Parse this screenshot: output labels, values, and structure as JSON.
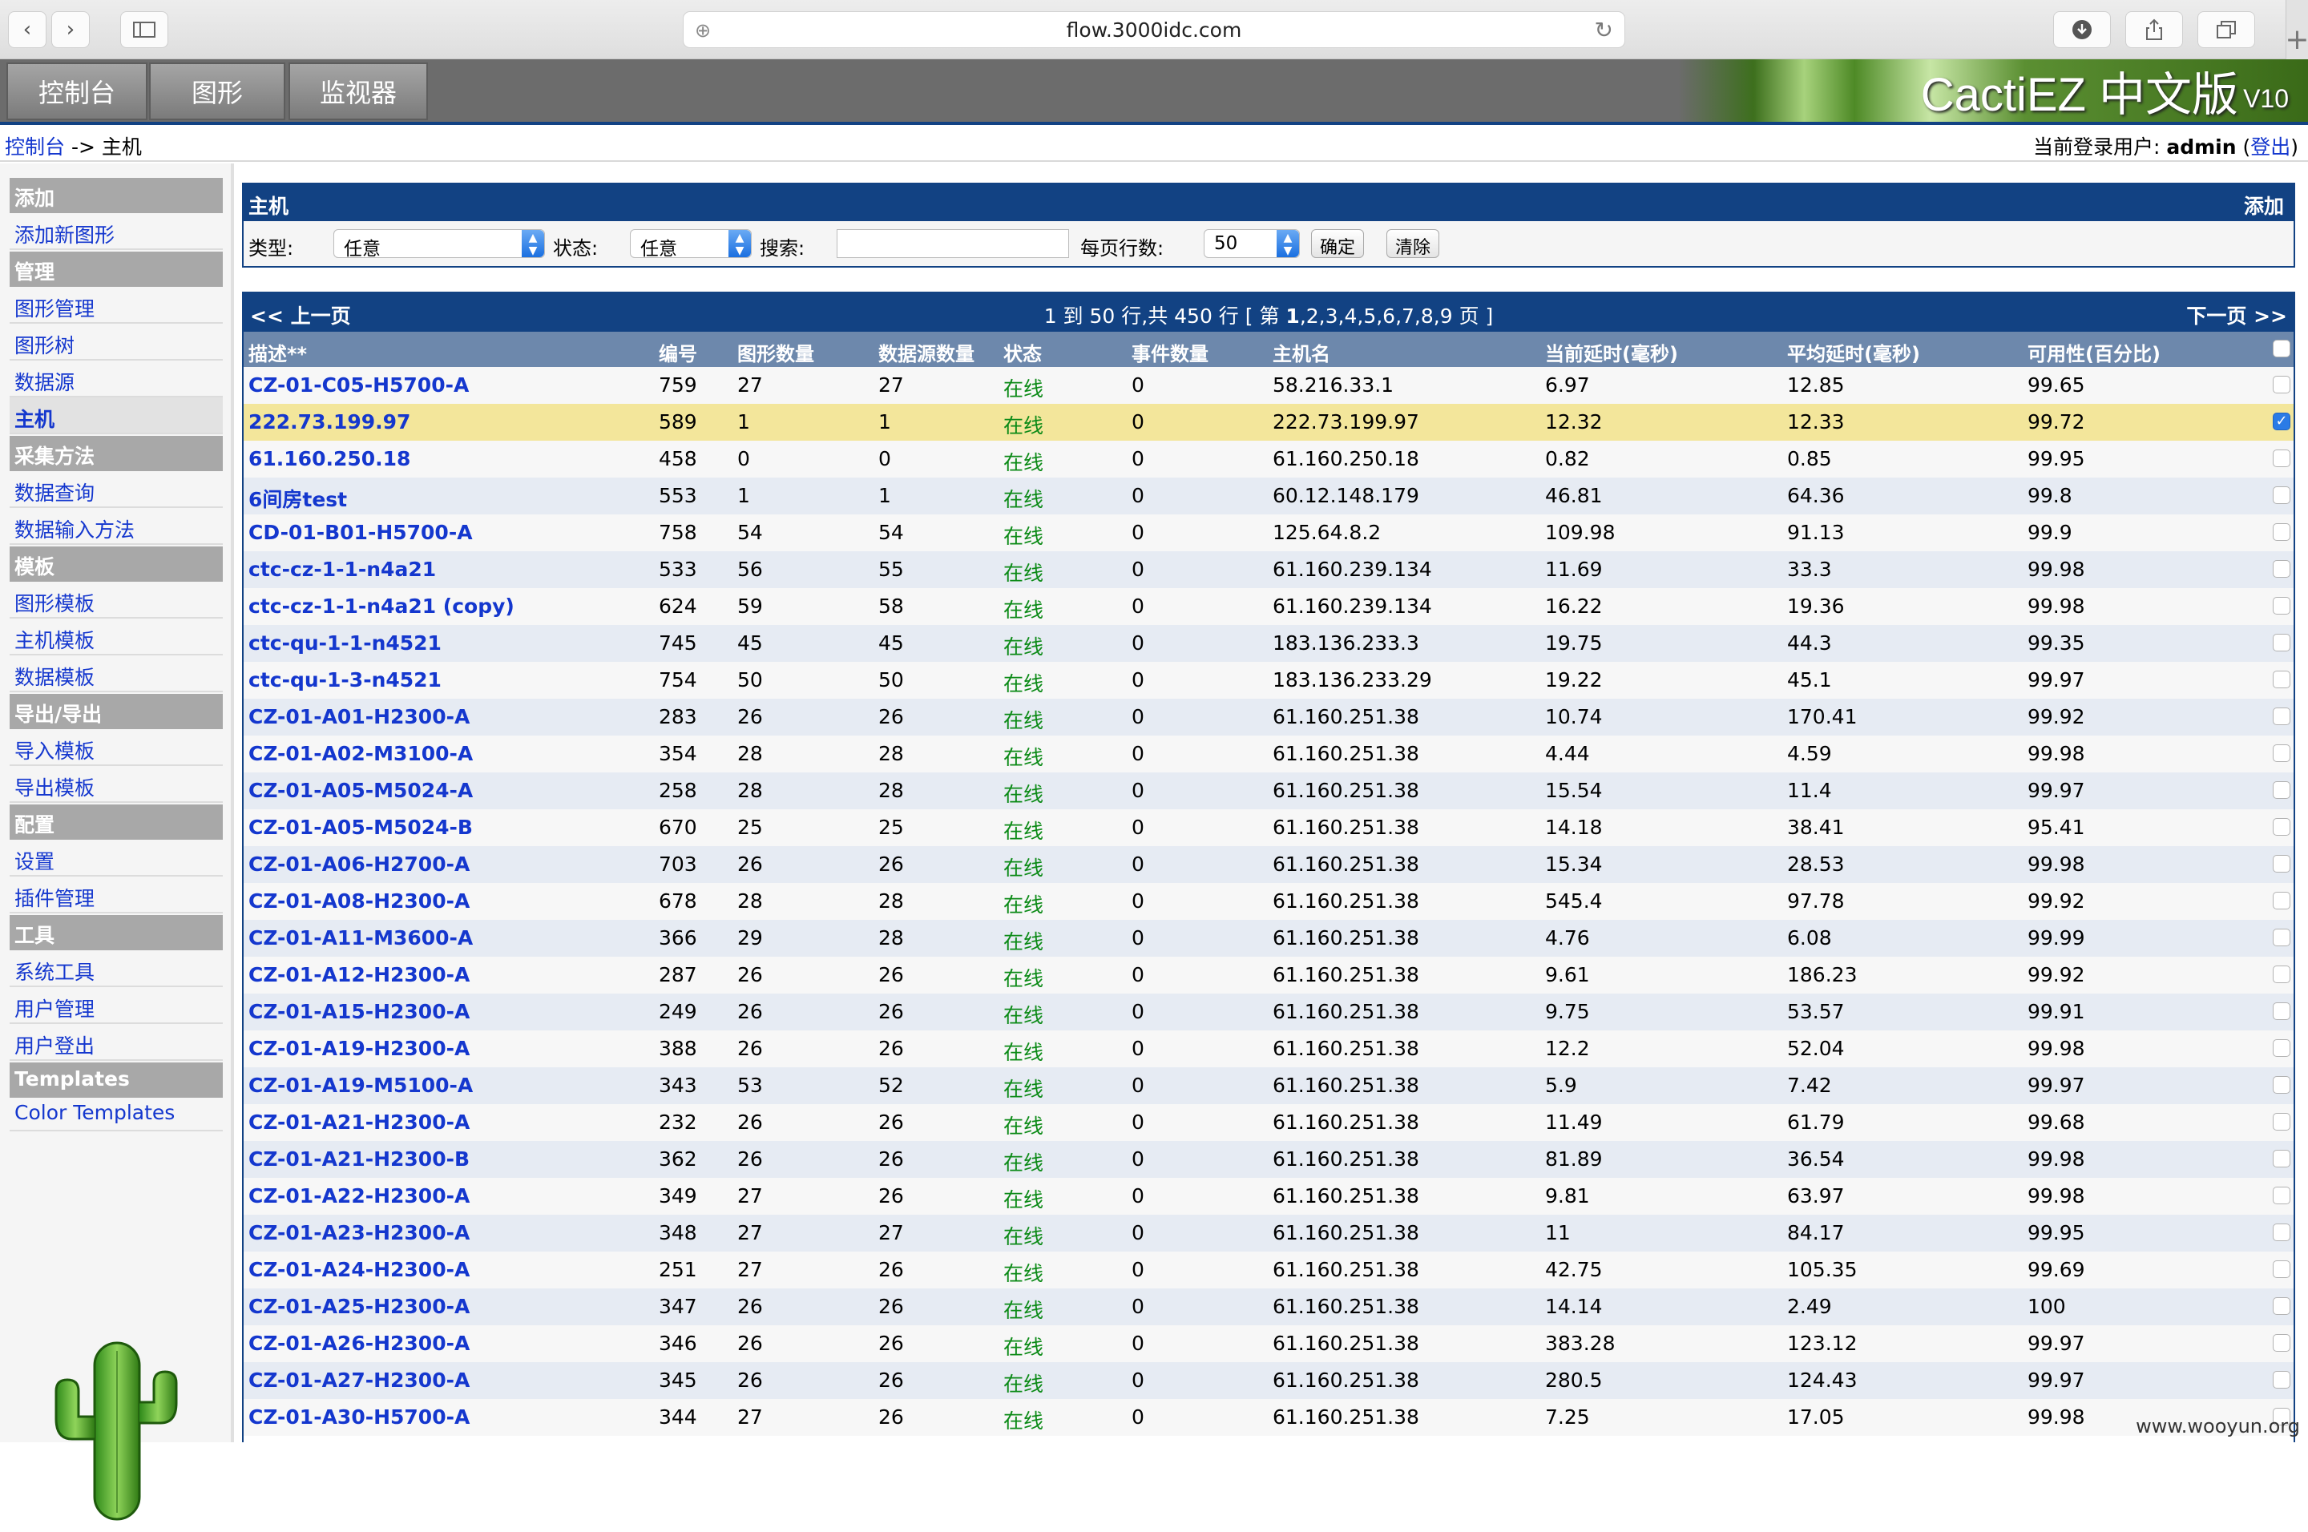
{
  "browser": {
    "url": "flow.3000idc.com",
    "new_tab_symbol": "+"
  },
  "header": {
    "tabs": [
      "控制台",
      "图形",
      "监视器"
    ],
    "logo": "CactiEZ 中文版",
    "logo_version": "V10"
  },
  "breadcrumb": {
    "root": "控制台",
    "sep": " -> ",
    "current": "主机"
  },
  "user": {
    "prefix": "当前登录用户: ",
    "name": "admin",
    "open": " (",
    "logout": "登出",
    "close": ")"
  },
  "sidebar": [
    {
      "type": "header",
      "label": "添加"
    },
    {
      "type": "item",
      "label": "添加新图形"
    },
    {
      "type": "header",
      "label": "管理"
    },
    {
      "type": "item",
      "label": "图形管理"
    },
    {
      "type": "item",
      "label": "图形树"
    },
    {
      "type": "item",
      "label": "数据源"
    },
    {
      "type": "item",
      "label": "主机",
      "selected": true
    },
    {
      "type": "header",
      "label": "采集方法"
    },
    {
      "type": "item",
      "label": "数据查询"
    },
    {
      "type": "item",
      "label": "数据输入方法"
    },
    {
      "type": "header",
      "label": "模板"
    },
    {
      "type": "item",
      "label": "图形模板"
    },
    {
      "type": "item",
      "label": "主机模板"
    },
    {
      "type": "item",
      "label": "数据模板"
    },
    {
      "type": "header",
      "label": "导出/导出"
    },
    {
      "type": "item",
      "label": "导入模板"
    },
    {
      "type": "item",
      "label": "导出模板"
    },
    {
      "type": "header",
      "label": "配置"
    },
    {
      "type": "item",
      "label": "设置"
    },
    {
      "type": "item",
      "label": "插件管理"
    },
    {
      "type": "header",
      "label": "工具"
    },
    {
      "type": "item",
      "label": "系统工具"
    },
    {
      "type": "item",
      "label": "用户管理"
    },
    {
      "type": "item",
      "label": "用户登出"
    },
    {
      "type": "header",
      "label": "Templates"
    },
    {
      "type": "item",
      "label": "Color Templates"
    }
  ],
  "filter": {
    "title": "主机",
    "add": "添加",
    "type_label": "类型:",
    "type_value": "任意",
    "status_label": "状态:",
    "status_value": "任意",
    "search_label": "搜索:",
    "search_value": "",
    "rows_label": "每页行数:",
    "rows_value": "50",
    "go": "确定",
    "clear": "清除"
  },
  "pager": {
    "prev": "<< 上一页",
    "summary_pre": "1 到 50 行,共 450 行 [ 第 ",
    "current_page": "1",
    "other_pages": ",2,3,4,5,6,7,8,9",
    "summary_post": " 页 ]",
    "next": "下一页 >>"
  },
  "columns": [
    "描述**",
    "编号",
    "图形数量",
    "数据源数量",
    "状态",
    "事件数量",
    "主机名",
    "当前延时(毫秒)",
    "平均延时(毫秒)",
    "可用性(百分比)"
  ],
  "rows": [
    {
      "desc": "CZ-01-C05-H5700-A",
      "id": "759",
      "graphs": "27",
      "ds": "27",
      "status": "在线",
      "events": "0",
      "host": "58.216.33.1",
      "cur": "6.97",
      "avg": "12.85",
      "avail": "99.65",
      "checked": false
    },
    {
      "desc": "222.73.199.97",
      "id": "589",
      "graphs": "1",
      "ds": "1",
      "status": "在线",
      "events": "0",
      "host": "222.73.199.97",
      "cur": "12.32",
      "avg": "12.33",
      "avail": "99.72",
      "checked": true
    },
    {
      "desc": "61.160.250.18",
      "id": "458",
      "graphs": "0",
      "ds": "0",
      "status": "在线",
      "events": "0",
      "host": "61.160.250.18",
      "cur": "0.82",
      "avg": "0.85",
      "avail": "99.95",
      "checked": false
    },
    {
      "desc": "6间房test",
      "id": "553",
      "graphs": "1",
      "ds": "1",
      "status": "在线",
      "events": "0",
      "host": "60.12.148.179",
      "cur": "46.81",
      "avg": "64.36",
      "avail": "99.8",
      "checked": false
    },
    {
      "desc": "CD-01-B01-H5700-A",
      "id": "758",
      "graphs": "54",
      "ds": "54",
      "status": "在线",
      "events": "0",
      "host": "125.64.8.2",
      "cur": "109.98",
      "avg": "91.13",
      "avail": "99.9",
      "checked": false
    },
    {
      "desc": "ctc-cz-1-1-n4a21",
      "id": "533",
      "graphs": "56",
      "ds": "55",
      "status": "在线",
      "events": "0",
      "host": "61.160.239.134",
      "cur": "11.69",
      "avg": "33.3",
      "avail": "99.98",
      "checked": false
    },
    {
      "desc": "ctc-cz-1-1-n4a21 (copy)",
      "id": "624",
      "graphs": "59",
      "ds": "58",
      "status": "在线",
      "events": "0",
      "host": "61.160.239.134",
      "cur": "16.22",
      "avg": "19.36",
      "avail": "99.98",
      "checked": false
    },
    {
      "desc": "ctc-qu-1-1-n4521",
      "id": "745",
      "graphs": "45",
      "ds": "45",
      "status": "在线",
      "events": "0",
      "host": "183.136.233.3",
      "cur": "19.75",
      "avg": "44.3",
      "avail": "99.35",
      "checked": false
    },
    {
      "desc": "ctc-qu-1-3-n4521",
      "id": "754",
      "graphs": "50",
      "ds": "50",
      "status": "在线",
      "events": "0",
      "host": "183.136.233.29",
      "cur": "19.22",
      "avg": "45.1",
      "avail": "99.97",
      "checked": false
    },
    {
      "desc": "CZ-01-A01-H2300-A",
      "id": "283",
      "graphs": "26",
      "ds": "26",
      "status": "在线",
      "events": "0",
      "host": "61.160.251.38",
      "cur": "10.74",
      "avg": "170.41",
      "avail": "99.92",
      "checked": false
    },
    {
      "desc": "CZ-01-A02-M3100-A",
      "id": "354",
      "graphs": "28",
      "ds": "28",
      "status": "在线",
      "events": "0",
      "host": "61.160.251.38",
      "cur": "4.44",
      "avg": "4.59",
      "avail": "99.98",
      "checked": false
    },
    {
      "desc": "CZ-01-A05-M5024-A",
      "id": "258",
      "graphs": "28",
      "ds": "28",
      "status": "在线",
      "events": "0",
      "host": "61.160.251.38",
      "cur": "15.54",
      "avg": "11.4",
      "avail": "99.97",
      "checked": false
    },
    {
      "desc": "CZ-01-A05-M5024-B",
      "id": "670",
      "graphs": "25",
      "ds": "25",
      "status": "在线",
      "events": "0",
      "host": "61.160.251.38",
      "cur": "14.18",
      "avg": "38.41",
      "avail": "95.41",
      "checked": false
    },
    {
      "desc": "CZ-01-A06-H2700-A",
      "id": "703",
      "graphs": "26",
      "ds": "26",
      "status": "在线",
      "events": "0",
      "host": "61.160.251.38",
      "cur": "15.34",
      "avg": "28.53",
      "avail": "99.98",
      "checked": false
    },
    {
      "desc": "CZ-01-A08-H2300-A",
      "id": "678",
      "graphs": "28",
      "ds": "28",
      "status": "在线",
      "events": "0",
      "host": "61.160.251.38",
      "cur": "545.4",
      "avg": "97.78",
      "avail": "99.92",
      "checked": false
    },
    {
      "desc": "CZ-01-A11-M3600-A",
      "id": "366",
      "graphs": "29",
      "ds": "28",
      "status": "在线",
      "events": "0",
      "host": "61.160.251.38",
      "cur": "4.76",
      "avg": "6.08",
      "avail": "99.99",
      "checked": false
    },
    {
      "desc": "CZ-01-A12-H2300-A",
      "id": "287",
      "graphs": "26",
      "ds": "26",
      "status": "在线",
      "events": "0",
      "host": "61.160.251.38",
      "cur": "9.61",
      "avg": "186.23",
      "avail": "99.92",
      "checked": false
    },
    {
      "desc": "CZ-01-A15-H2300-A",
      "id": "249",
      "graphs": "26",
      "ds": "26",
      "status": "在线",
      "events": "0",
      "host": "61.160.251.38",
      "cur": "9.75",
      "avg": "53.57",
      "avail": "99.91",
      "checked": false
    },
    {
      "desc": "CZ-01-A19-H2300-A",
      "id": "388",
      "graphs": "26",
      "ds": "26",
      "status": "在线",
      "events": "0",
      "host": "61.160.251.38",
      "cur": "12.2",
      "avg": "52.04",
      "avail": "99.98",
      "checked": false
    },
    {
      "desc": "CZ-01-A19-M5100-A",
      "id": "343",
      "graphs": "53",
      "ds": "52",
      "status": "在线",
      "events": "0",
      "host": "61.160.251.38",
      "cur": "5.9",
      "avg": "7.42",
      "avail": "99.97",
      "checked": false
    },
    {
      "desc": "CZ-01-A21-H2300-A",
      "id": "232",
      "graphs": "26",
      "ds": "26",
      "status": "在线",
      "events": "0",
      "host": "61.160.251.38",
      "cur": "11.49",
      "avg": "61.79",
      "avail": "99.68",
      "checked": false
    },
    {
      "desc": "CZ-01-A21-H2300-B",
      "id": "362",
      "graphs": "26",
      "ds": "26",
      "status": "在线",
      "events": "0",
      "host": "61.160.251.38",
      "cur": "81.89",
      "avg": "36.54",
      "avail": "99.98",
      "checked": false
    },
    {
      "desc": "CZ-01-A22-H2300-A",
      "id": "349",
      "graphs": "27",
      "ds": "26",
      "status": "在线",
      "events": "0",
      "host": "61.160.251.38",
      "cur": "9.81",
      "avg": "63.97",
      "avail": "99.98",
      "checked": false
    },
    {
      "desc": "CZ-01-A23-H2300-A",
      "id": "348",
      "graphs": "27",
      "ds": "27",
      "status": "在线",
      "events": "0",
      "host": "61.160.251.38",
      "cur": "11",
      "avg": "84.17",
      "avail": "99.95",
      "checked": false
    },
    {
      "desc": "CZ-01-A24-H2300-A",
      "id": "251",
      "graphs": "27",
      "ds": "26",
      "status": "在线",
      "events": "0",
      "host": "61.160.251.38",
      "cur": "42.75",
      "avg": "105.35",
      "avail": "99.69",
      "checked": false
    },
    {
      "desc": "CZ-01-A25-H2300-A",
      "id": "347",
      "graphs": "26",
      "ds": "26",
      "status": "在线",
      "events": "0",
      "host": "61.160.251.38",
      "cur": "14.14",
      "avg": "2.49",
      "avail": "100",
      "checked": false
    },
    {
      "desc": "CZ-01-A26-H2300-A",
      "id": "346",
      "graphs": "26",
      "ds": "26",
      "status": "在线",
      "events": "0",
      "host": "61.160.251.38",
      "cur": "383.28",
      "avg": "123.12",
      "avail": "99.97",
      "checked": false
    },
    {
      "desc": "CZ-01-A27-H2300-A",
      "id": "345",
      "graphs": "26",
      "ds": "26",
      "status": "在线",
      "events": "0",
      "host": "61.160.251.38",
      "cur": "280.5",
      "avg": "124.43",
      "avail": "99.97",
      "checked": false
    },
    {
      "desc": "CZ-01-A30-H5700-A",
      "id": "344",
      "graphs": "27",
      "ds": "26",
      "status": "在线",
      "events": "0",
      "host": "61.160.251.38",
      "cur": "7.25",
      "avg": "17.05",
      "avail": "99.98",
      "checked": false
    }
  ],
  "watermark": "www.wooyun.org"
}
